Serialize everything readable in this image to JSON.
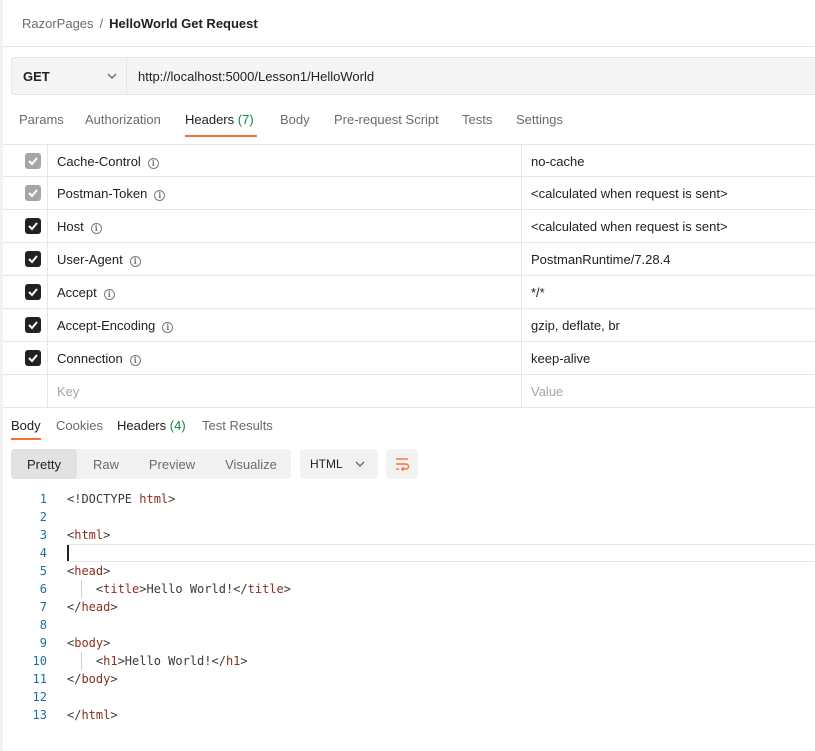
{
  "breadcrumb": {
    "parent": "RazorPages",
    "separator": "/",
    "current": "HelloWorld Get Request"
  },
  "request": {
    "method": "GET",
    "url": "http://localhost:5000/Lesson1/HelloWorld"
  },
  "request_tabs": [
    {
      "label": "Params"
    },
    {
      "label": "Authorization"
    },
    {
      "label": "Headers",
      "count": "(7)",
      "active": true
    },
    {
      "label": "Body"
    },
    {
      "label": "Pre-request Script"
    },
    {
      "label": "Tests"
    },
    {
      "label": "Settings"
    }
  ],
  "headers": [
    {
      "key": "Cache-Control",
      "value": "no-cache",
      "state": "fixed"
    },
    {
      "key": "Postman-Token",
      "value": "<calculated when request is sent>",
      "state": "fixed"
    },
    {
      "key": "Host",
      "value": "<calculated when request is sent>",
      "state": "on"
    },
    {
      "key": "User-Agent",
      "value": "PostmanRuntime/7.28.4",
      "state": "on"
    },
    {
      "key": "Accept",
      "value": "*/*",
      "state": "on"
    },
    {
      "key": "Accept-Encoding",
      "value": "gzip, deflate, br",
      "state": "on"
    },
    {
      "key": "Connection",
      "value": "keep-alive",
      "state": "on"
    }
  ],
  "new_header": {
    "key_placeholder": "Key",
    "value_placeholder": "Value"
  },
  "response_tabs": [
    {
      "label": "Body",
      "active": true
    },
    {
      "label": "Cookies"
    },
    {
      "label": "Headers",
      "count": "(4)"
    },
    {
      "label": "Test Results"
    }
  ],
  "view_modes": [
    "Pretty",
    "Raw",
    "Preview",
    "Visualize"
  ],
  "active_view": "Pretty",
  "language": "HTML",
  "code_lines": [
    {
      "n": "1",
      "text": "<!DOCTYPE html>"
    },
    {
      "n": "2",
      "text": ""
    },
    {
      "n": "3",
      "text": "<html>"
    },
    {
      "n": "4",
      "text": ""
    },
    {
      "n": "5",
      "text": "<head>"
    },
    {
      "n": "6",
      "text": "    <title>Hello World!</title>"
    },
    {
      "n": "7",
      "text": "</head>"
    },
    {
      "n": "8",
      "text": ""
    },
    {
      "n": "9",
      "text": "<body>"
    },
    {
      "n": "10",
      "text": "    <h1>Hello World!</h1>"
    },
    {
      "n": "11",
      "text": "</body>"
    },
    {
      "n": "12",
      "text": ""
    },
    {
      "n": "13",
      "text": "</html>"
    }
  ],
  "colors": {
    "accent": "#ff6c37",
    "count": "#0a8a3e",
    "line_numbers": "#1d6fa5",
    "tag": "#8b2e1f"
  }
}
